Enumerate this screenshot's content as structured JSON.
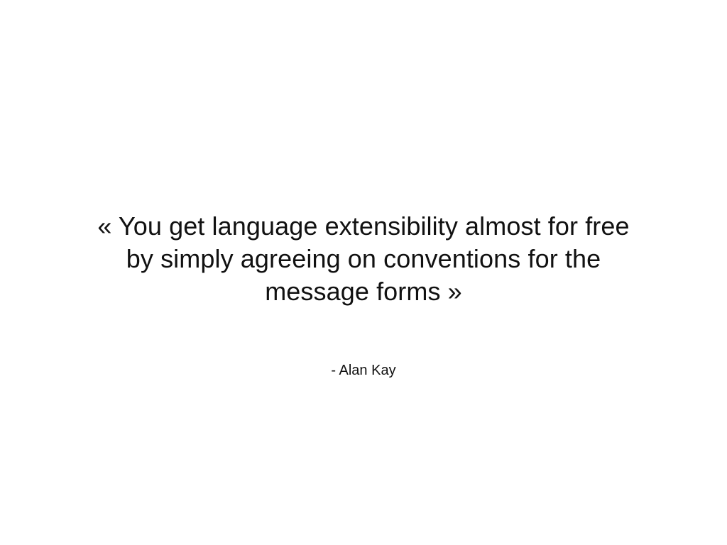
{
  "slide": {
    "quote_lines": [
      "« You get language extensibility almost for free",
      "by simply agreeing on conventions for the",
      "message forms »"
    ],
    "attribution": "- Alan Kay"
  },
  "colors": {
    "background": "#ffffff",
    "text": "#111111"
  }
}
